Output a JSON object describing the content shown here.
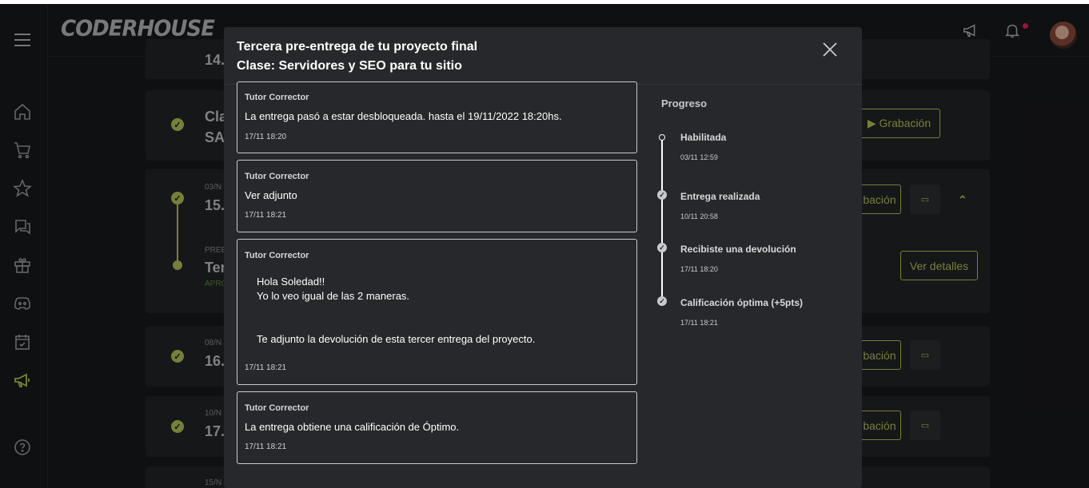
{
  "app": {
    "logo": "CODERHOUSE"
  },
  "background": {
    "cards": [
      {
        "date": "",
        "title": "14."
      },
      {
        "date": "",
        "title": "Cla\nSA",
        "button": "▶ Grabación"
      },
      {
        "date": "03/N",
        "title": "15.",
        "button": "bación"
      },
      {
        "date": "PREE",
        "title": "Ter",
        "sub": "APRO",
        "button": "Ver detalles"
      },
      {
        "date": "08/N",
        "title": "16.",
        "button": "bación"
      },
      {
        "date": "10/N",
        "title": "17.",
        "button": "bación"
      },
      {
        "date": "15/N",
        "title": ""
      }
    ]
  },
  "modal": {
    "title_line1": "Tercera pre-entrega de tu proyecto final",
    "title_line2": "Clase: Servidores y SEO para tu sitio",
    "messages": [
      {
        "author": "Tutor Corrector",
        "text": "La entrega pasó a estar desbloqueada. hasta el 19/11/2022 18:20hs.",
        "time": "17/11 18:20"
      },
      {
        "author": "Tutor Corrector",
        "text": "Ver adjunto",
        "time": "17/11 18:21"
      },
      {
        "author": "Tutor Corrector",
        "text": "Hola Soledad!!\nYo lo veo igual de las 2 maneras.\n\n\nTe adjunto la devolución de esta tercer entrega del proyecto.",
        "time": "17/11 18:21"
      },
      {
        "author": "Tutor Corrector",
        "text": "La entrega obtiene una calificación de Óptimo.",
        "time": "17/11 18:21"
      }
    ],
    "progress": {
      "title": "Progreso",
      "steps": [
        {
          "label": "Habilitada",
          "time": "03/11 12:59"
        },
        {
          "label": "Entrega realizada",
          "time": "10/11 20:58"
        },
        {
          "label": "Recibiste una devolución",
          "time": "17/11 18:20"
        },
        {
          "label": "Calificación óptima (+5pts)",
          "time": "17/11 18:21"
        }
      ]
    }
  },
  "colors": {
    "accent": "#b7c45a",
    "modal_bg": "#27282b",
    "page_bg": "#18191b"
  }
}
